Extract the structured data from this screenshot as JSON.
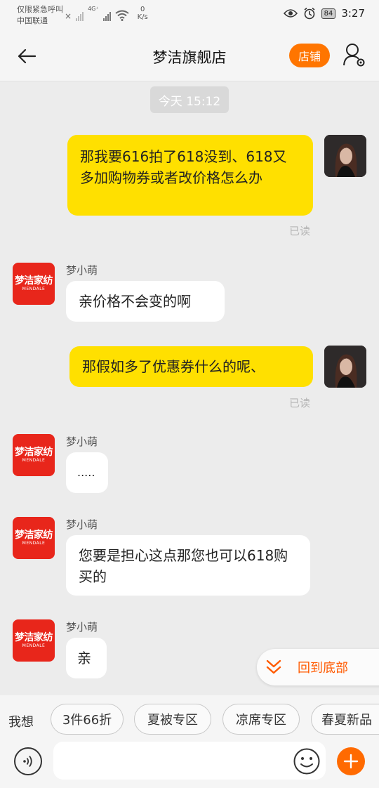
{
  "status_bar": {
    "carrier_line1": "仅限紧急呼叫",
    "carrier_line2": "中国联通",
    "network": "4G⁺",
    "speed_value": "0",
    "speed_unit": "K/s",
    "battery": "84",
    "time": "3:27"
  },
  "nav": {
    "title": "梦洁旗舰店",
    "shop_button": "店铺"
  },
  "chat": {
    "time_chip": "今天  15:12",
    "read_label": "已读",
    "shop_sender": "梦小萌",
    "shop_logo_cn": "梦洁家纺",
    "shop_logo_en": "MENDALE",
    "messages": [
      {
        "from": "me",
        "text": "那我要616拍了618没到、618又多加购物券或者改价格怎么办"
      },
      {
        "from": "shop",
        "text": "亲价格不会变的啊"
      },
      {
        "from": "me",
        "text": "那假如多了优惠券什么的呢、"
      },
      {
        "from": "shop",
        "text": "....."
      },
      {
        "from": "shop",
        "text": "您要是担心这点那您也可以618购买的"
      },
      {
        "from": "shop",
        "text": "亲"
      }
    ],
    "scroll_to_bottom": "回到底部"
  },
  "quick_bar": {
    "label": "我想",
    "chips": [
      "3件66折",
      "夏被专区",
      "凉席专区",
      "春夏新品"
    ]
  },
  "input": {
    "value": "",
    "placeholder": ""
  },
  "colors": {
    "accent": "#ff6a00",
    "my_bubble": "#ffe000",
    "shop_avatar": "#e8261b"
  },
  "icons": [
    "back-arrow-icon",
    "profile-settings-icon",
    "voice-icon",
    "emoji-icon",
    "plus-icon",
    "double-chevron-down-icon"
  ]
}
